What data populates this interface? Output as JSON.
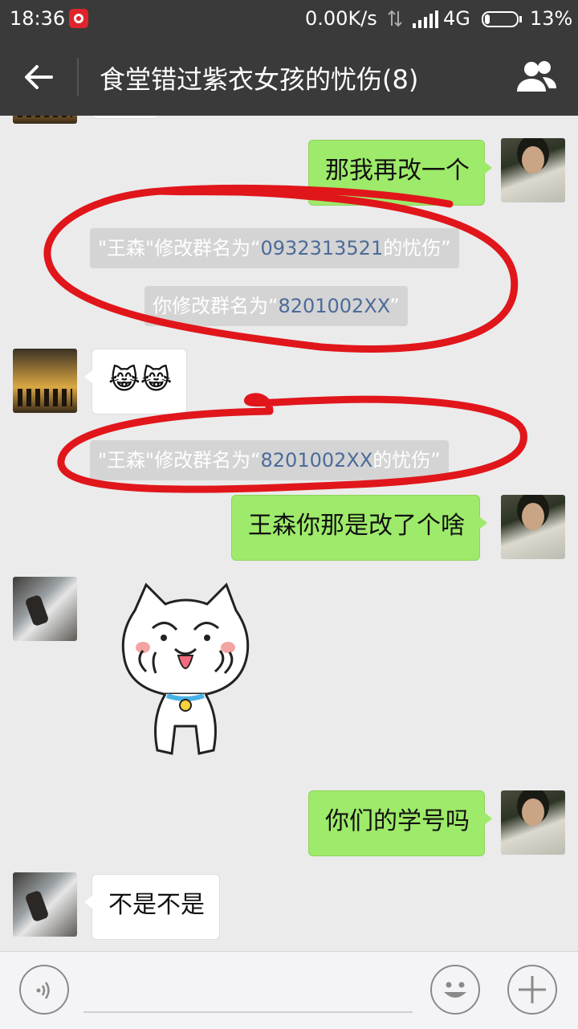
{
  "status_bar": {
    "time": "18:36",
    "net_speed": "0.00K/s",
    "network": "4G",
    "battery": "13%"
  },
  "header": {
    "title": "食堂错过紫衣女孩的忧伤(8)"
  },
  "messages": [
    {
      "from": "me",
      "text": "那我再改一个"
    },
    {
      "system": true,
      "prefix": "\"王森\"修改群名为“",
      "highlight": "0932313521",
      "suffix": "的忧伤”"
    },
    {
      "system": true,
      "prefix": "你修改群名为“",
      "highlight": "8201002XX",
      "suffix": "”"
    },
    {
      "from": "other",
      "text": "😹😹"
    },
    {
      "system": true,
      "prefix": "\"王森\"修改群名为“",
      "highlight": "8201002XX",
      "suffix": "的忧伤”"
    },
    {
      "from": "me",
      "text": "王森你那是改了个啥"
    },
    {
      "from": "other",
      "sticker": "cat-sticker"
    },
    {
      "from": "me",
      "text": "你们的学号吗"
    },
    {
      "from": "other",
      "text": "不是不是"
    }
  ],
  "colors": {
    "me_bubble": "#9eea6a",
    "other_bubble": "#ffffff",
    "header": "#3a3a3a",
    "circle": "#e0161b"
  },
  "icons": [
    "back-arrow-icon",
    "group-members-icon",
    "voice-icon",
    "emoji-icon",
    "plus-icon"
  ]
}
